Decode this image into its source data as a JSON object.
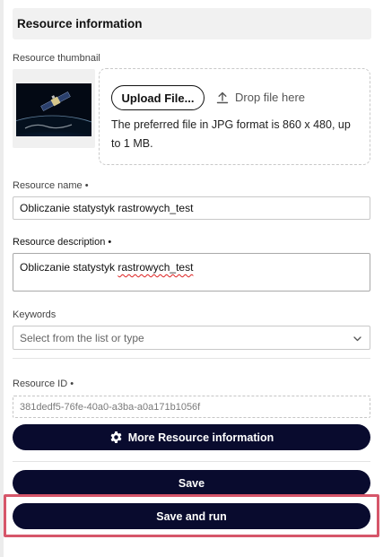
{
  "section": {
    "title": "Resource information"
  },
  "thumbnail": {
    "label": "Resource thumbnail",
    "upload_button": "Upload File...",
    "drop_hint": "Drop file here",
    "note": "The preferred file in JPG format is 860 x 480, up to 1 MB.",
    "image_icon": "satellite-over-earth"
  },
  "resource_name": {
    "label": "Resource name •",
    "value": "Obliczanie statystyk rastrowych_test"
  },
  "resource_description": {
    "label": "Resource description •",
    "value_part1": "Obliczanie statystyk ",
    "value_part2": "rastrowych_test"
  },
  "keywords": {
    "label": "Keywords",
    "placeholder": "Select from the list or type"
  },
  "resource_id": {
    "label": "Resource ID •",
    "value": "381dedf5-76fe-40a0-a3ba-a0a171b1056f"
  },
  "buttons": {
    "more_info": "More Resource information",
    "save": "Save",
    "save_and_run": "Save and run"
  },
  "colors": {
    "primary": "#090b2e",
    "highlight": "#d6566a",
    "header_bg": "#f1f1f1"
  }
}
